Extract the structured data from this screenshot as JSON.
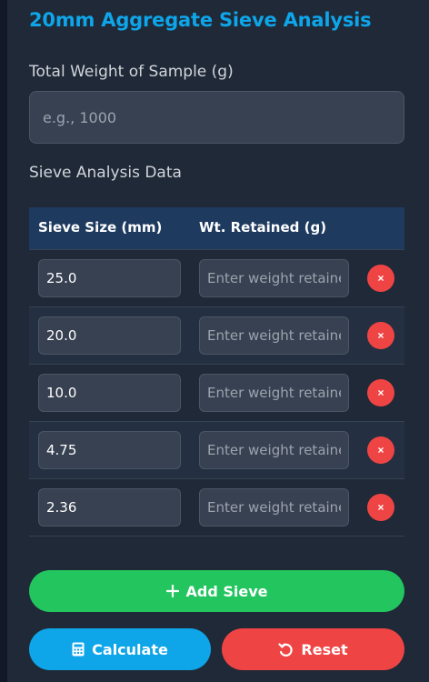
{
  "page": {
    "title": "20mm Aggregate Sieve Analysis"
  },
  "sample": {
    "label": "Total Weight of Sample (g)",
    "value": "",
    "placeholder": "e.g., 1000"
  },
  "sieve_section": {
    "label": "Sieve Analysis Data",
    "headers": {
      "size": "Sieve Size (mm)",
      "weight": "Wt. Retained (g)"
    },
    "rows": [
      {
        "size": "25.0",
        "weight": "",
        "weight_placeholder": "Enter weight retained"
      },
      {
        "size": "20.0",
        "weight": "",
        "weight_placeholder": "Enter weight retained"
      },
      {
        "size": "10.0",
        "weight": "",
        "weight_placeholder": "Enter weight retained"
      },
      {
        "size": "4.75",
        "weight": "",
        "weight_placeholder": "Enter weight retained"
      },
      {
        "size": "2.36",
        "weight": "",
        "weight_placeholder": "Enter weight retained"
      }
    ],
    "remove_glyph": "×"
  },
  "buttons": {
    "add": {
      "label": "Add Sieve",
      "icon": "plus-icon"
    },
    "calculate": {
      "label": "Calculate",
      "icon": "calculator-icon"
    },
    "reset": {
      "label": "Reset",
      "icon": "undo-icon"
    }
  },
  "colors": {
    "accent": "#0ea5e9",
    "add": "#22c55e",
    "danger": "#ef4444",
    "header_bg": "#1e3a5f"
  }
}
